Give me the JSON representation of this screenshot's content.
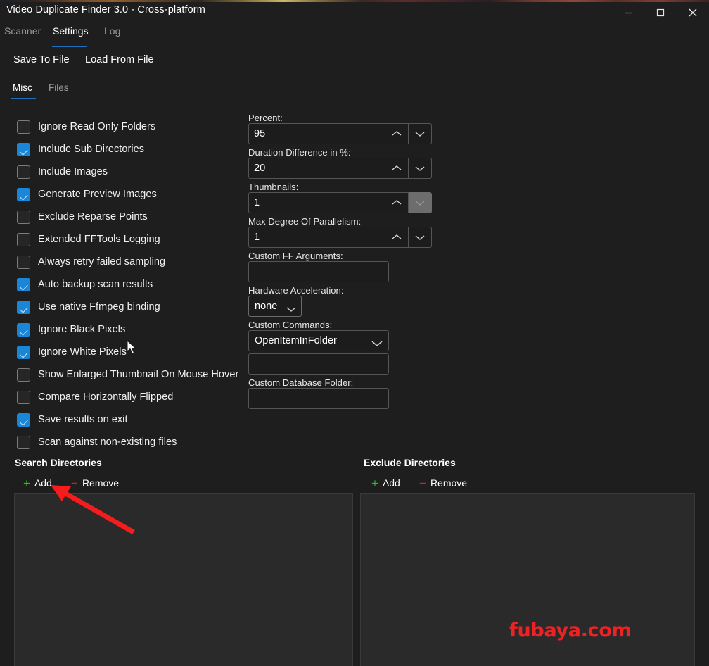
{
  "window": {
    "title": "Video Duplicate Finder 3.0 - Cross-platform",
    "controls": {
      "minimize": "minimize-icon",
      "maximize": "maximize-icon",
      "close": "close-icon"
    }
  },
  "colors": {
    "accent": "#1f6fbf",
    "checkbox_on": "#1a86d8",
    "add_green": "#2eb82e",
    "remove_red": "#cc2222",
    "watermark_red": "#ee2222",
    "background": "#1e1e1e",
    "listbox": "#2a2a2a"
  },
  "tabs": [
    {
      "label": "Scanner",
      "active": false
    },
    {
      "label": "Settings",
      "active": true
    },
    {
      "label": "Log",
      "active": false
    }
  ],
  "toolbar": {
    "save_to_file": "Save To File",
    "load_from_file": "Load From File"
  },
  "subtabs": [
    {
      "label": "Misc",
      "active": true
    },
    {
      "label": "Files",
      "active": false
    }
  ],
  "checkboxes": [
    {
      "label": "Ignore Read Only Folders",
      "checked": false
    },
    {
      "label": "Include Sub Directories",
      "checked": true
    },
    {
      "label": "Include Images",
      "checked": false
    },
    {
      "label": "Generate Preview Images",
      "checked": true
    },
    {
      "label": "Exclude Reparse Points",
      "checked": false
    },
    {
      "label": "Extended FFTools Logging",
      "checked": false
    },
    {
      "label": "Always retry failed sampling",
      "checked": false
    },
    {
      "label": "Auto backup scan results",
      "checked": true
    },
    {
      "label": "Use native Ffmpeg binding",
      "checked": true
    },
    {
      "label": "Ignore Black Pixels",
      "checked": true
    },
    {
      "label": "Ignore White Pixels",
      "checked": true
    },
    {
      "label": "Show Enlarged Thumbnail On Mouse Hover",
      "checked": false
    },
    {
      "label": "Compare Horizontally Flipped",
      "checked": false
    },
    {
      "label": "Save results on exit",
      "checked": true
    },
    {
      "label": "Scan against non-existing files",
      "checked": false
    }
  ],
  "form": {
    "percent": {
      "label": "Percent:",
      "value": "95"
    },
    "duration_diff": {
      "label": "Duration Difference in %:",
      "value": "20"
    },
    "thumbnails": {
      "label": "Thumbnails:",
      "value": "1",
      "down_hovered": true
    },
    "parallelism": {
      "label": "Max Degree Of Parallelism:",
      "value": "1"
    },
    "custom_ff_args": {
      "label": "Custom FF Arguments:",
      "value": "",
      "placeholder": ""
    },
    "hardware_accel": {
      "label": "Hardware Acceleration:",
      "value": "none",
      "options": [
        "none"
      ]
    },
    "custom_commands": {
      "label": "Custom Commands:",
      "value": "OpenItemInFolder",
      "options": [
        "OpenItemInFolder"
      ]
    },
    "custom_command_value": {
      "value": "",
      "placeholder": ""
    },
    "custom_db_folder": {
      "label": "Custom Database Folder:",
      "value": "",
      "placeholder": ""
    }
  },
  "directories": {
    "search": {
      "title": "Search Directories",
      "add": "Add",
      "remove": "Remove",
      "items": []
    },
    "exclude": {
      "title": "Exclude Directories",
      "add": "Add",
      "remove": "Remove",
      "items": []
    }
  },
  "watermark": "fubaya.com"
}
